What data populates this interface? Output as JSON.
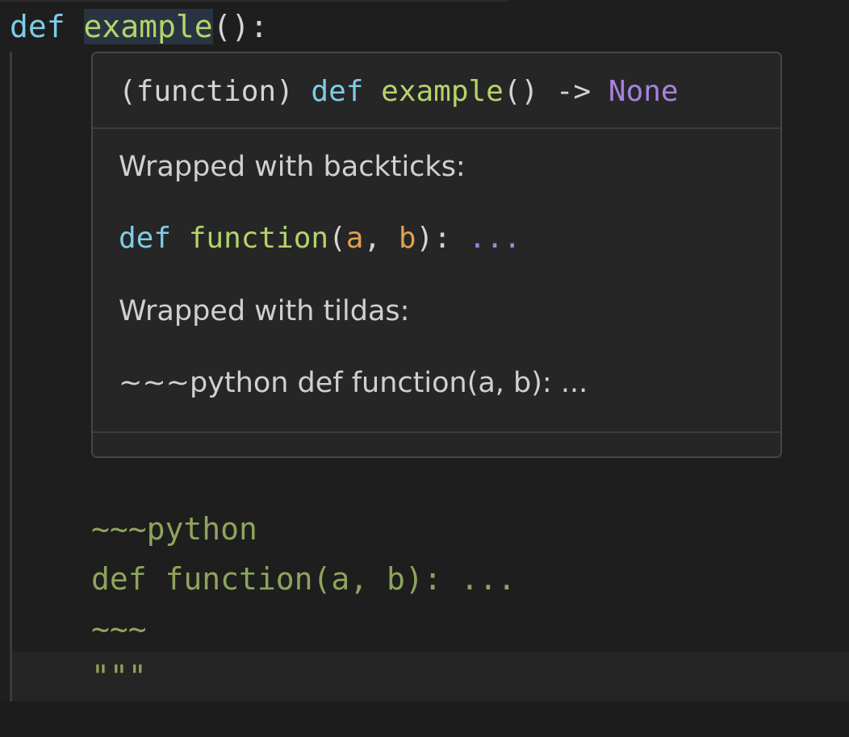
{
  "editor": {
    "line1": {
      "keyword": "def",
      "name": "example",
      "rest": "():"
    },
    "docstring_lines": [
      "~~~python",
      "def function(a, b): ...",
      "~~~",
      "\"\"\""
    ]
  },
  "hover": {
    "signature": {
      "prefix": "(function) ",
      "keyword": "def",
      "name": "example",
      "parens": "() -> ",
      "return_type": "None"
    },
    "paragraph1": "Wrapped with backticks:",
    "code": {
      "keyword": "def",
      "name": "function",
      "open": "(",
      "param_a": "a",
      "comma": ", ",
      "param_b": "b",
      "close": "): ",
      "ellipsis": "..."
    },
    "paragraph2": "Wrapped with tildas:",
    "paragraph3": "~~~python def function(a, b): ..."
  },
  "colors": {
    "background": "#1e1e1e",
    "keyword": "#7fcce6",
    "function_name": "#b5d36a",
    "docstring": "#8ea45c",
    "none_keyword": "#a682dc",
    "parameter": "#e0a050",
    "hover_background": "#262626",
    "hover_border": "#454545"
  }
}
